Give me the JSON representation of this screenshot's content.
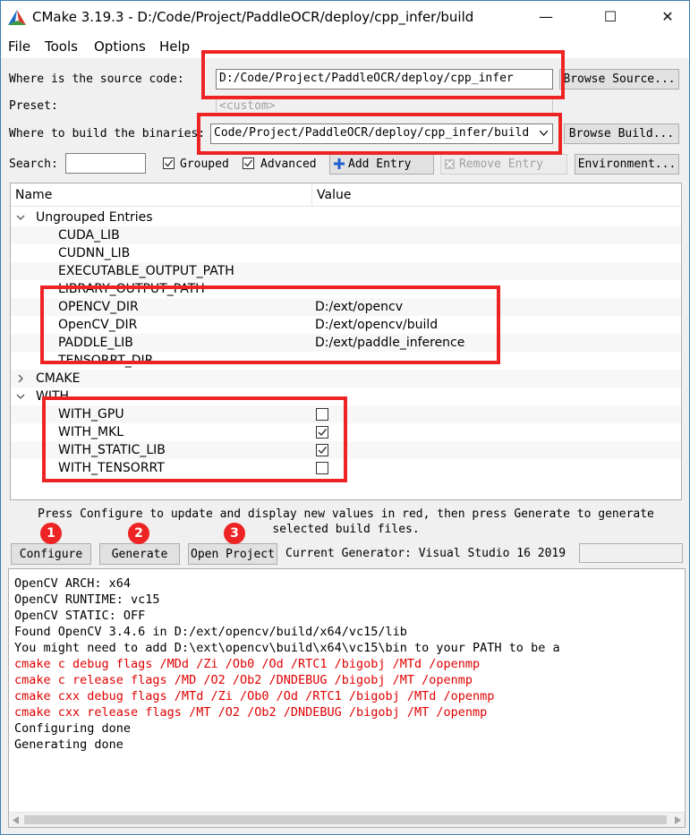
{
  "window": {
    "title": "CMake 3.19.3 - D:/Code/Project/PaddleOCR/deploy/cpp_infer/build",
    "minimize": "—",
    "maximize": "☐",
    "close": "✕"
  },
  "menu": [
    "File",
    "Tools",
    "Options",
    "Help"
  ],
  "source": {
    "label": "Where is the source code:",
    "value": "D:/Code/Project/PaddleOCR/deploy/cpp_infer",
    "browse": "Browse Source..."
  },
  "preset": {
    "label": "Preset:",
    "value": "<custom>"
  },
  "build": {
    "label": "Where to build the binaries:",
    "value": "Code/Project/PaddleOCR/deploy/cpp_infer/build",
    "browse": "Browse Build..."
  },
  "toolbar": {
    "search_label": "Search:",
    "search_value": "",
    "grouped_label": "Grouped",
    "grouped_checked": true,
    "advanced_label": "Advanced",
    "advanced_checked": true,
    "add_entry": "Add Entry",
    "remove_entry": "Remove Entry",
    "environment": "Environment..."
  },
  "tree": {
    "col_name": "Name",
    "col_value": "Value",
    "rows": [
      {
        "name": "Ungrouped Entries",
        "value": "",
        "group": true,
        "expanded": true
      },
      {
        "name": "CUDA_LIB",
        "value": ""
      },
      {
        "name": "CUDNN_LIB",
        "value": ""
      },
      {
        "name": "EXECUTABLE_OUTPUT_PATH",
        "value": ""
      },
      {
        "name": "LIBRARY_OUTPUT_PATH",
        "value": ""
      },
      {
        "name": "OPENCV_DIR",
        "value": "D:/ext/opencv"
      },
      {
        "name": "OpenCV_DIR",
        "value": "D:/ext/opencv/build"
      },
      {
        "name": "PADDLE_LIB",
        "value": "D:/ext/paddle_inference"
      },
      {
        "name": "TENSORRT_DIR",
        "value": ""
      },
      {
        "name": "CMAKE",
        "value": "",
        "group": true,
        "expanded": false
      },
      {
        "name": "WITH",
        "value": "",
        "group": true,
        "expanded": true
      },
      {
        "name": "WITH_GPU",
        "value": "",
        "bool": true,
        "checked": false
      },
      {
        "name": "WITH_MKL",
        "value": "",
        "bool": true,
        "checked": true
      },
      {
        "name": "WITH_STATIC_LIB",
        "value": "",
        "bool": true,
        "checked": true
      },
      {
        "name": "WITH_TENSORRT",
        "value": "",
        "bool": true,
        "checked": false
      }
    ]
  },
  "status": {
    "line1": "Press Configure to update and display new values in red, then press Generate to generate",
    "line2": "selected build files."
  },
  "actions": {
    "configure": "Configure",
    "generate": "Generate",
    "open_project": "Open Project",
    "generator_label": "Current Generator: Visual Studio 16 2019"
  },
  "badges": [
    "1",
    "2",
    "3"
  ],
  "output": {
    "lines": [
      {
        "text": "OpenCV ARCH: x64",
        "color": "#000000"
      },
      {
        "text": "OpenCV RUNTIME: vc15",
        "color": "#000000"
      },
      {
        "text": "OpenCV STATIC: OFF",
        "color": "#000000"
      },
      {
        "text": "Found OpenCV 3.4.6 in D:/ext/opencv/build/x64/vc15/lib",
        "color": "#000000"
      },
      {
        "text": "You might need to add D:\\ext\\opencv\\build\\x64\\vc15\\bin to your PATH to be a",
        "color": "#000000"
      },
      {
        "text": "cmake c debug flags /MDd /Zi /Ob0 /Od /RTC1 /bigobj /MTd /openmp",
        "color": "#e00000"
      },
      {
        "text": "cmake c release flags /MD /O2 /Ob2 /DNDEBUG /bigobj /MT /openmp",
        "color": "#e00000"
      },
      {
        "text": "cmake cxx debug flags /MTd /Zi /Ob0 /Od /RTC1 /bigobj /MTd /openmp",
        "color": "#e00000"
      },
      {
        "text": "cmake cxx release flags /MT /O2 /Ob2 /DNDEBUG /bigobj /MT /openmp",
        "color": "#e00000"
      },
      {
        "text": "Configuring done",
        "color": "#000000"
      },
      {
        "text": "Generating done",
        "color": "#000000"
      }
    ]
  },
  "colors": {
    "highlight": "#ee2424",
    "error_text": "#e00000",
    "window_border": "#3c7fb1"
  }
}
